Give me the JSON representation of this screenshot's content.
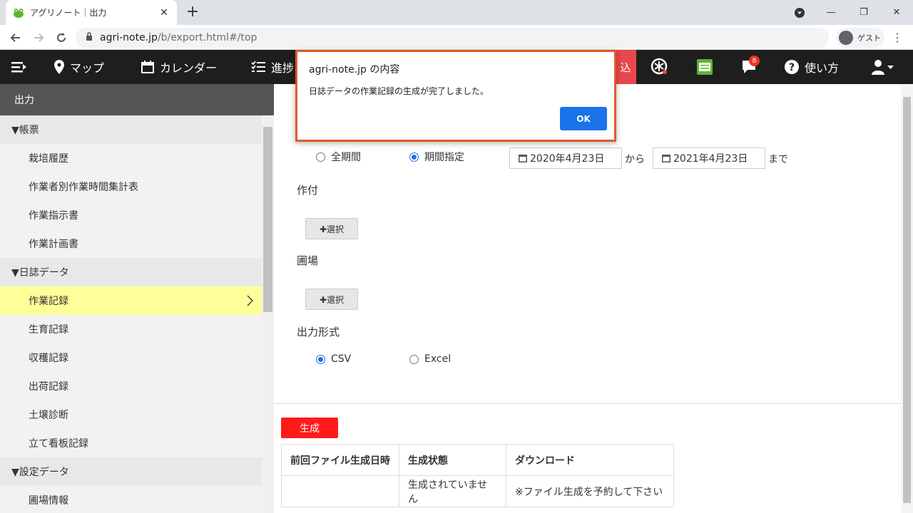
{
  "browser": {
    "tab_title": "アグリノート｜出力",
    "tab_close": "✕",
    "new_tab": "+",
    "url_host": "agri-note.jp",
    "url_path": "/b/export.html#/top",
    "guest_label": "ゲスト",
    "minimize": "—",
    "maximize": "❐",
    "close": "✕"
  },
  "appbar": {
    "map": "マップ",
    "calendar": "カレンダー",
    "progress": "進捗",
    "red_label": "込",
    "notification_count": "8",
    "help": "使い方"
  },
  "sidebar": {
    "title": "出力",
    "sections": [
      {
        "label": "▼帳票",
        "items": [
          "栽培履歴",
          "作業者別作業時間集計表",
          "作業指示書",
          "作業計画書"
        ]
      },
      {
        "label": "▼日誌データ",
        "items": [
          "作業記録",
          "生育記録",
          "収穫記録",
          "出荷記録",
          "土壌診断",
          "立て看板記録"
        ]
      },
      {
        "label": "▼設定データ",
        "items": [
          "圃場情報"
        ]
      }
    ],
    "active_item": "作業記録"
  },
  "form": {
    "period_all": "全期間",
    "period_range": "期間指定",
    "date_from": "2020年4月23日",
    "from_label": "から",
    "date_to": "2021年4月23日",
    "to_label": "まで",
    "crop_label": "作付",
    "select_label": "✚選択",
    "field_label": "圃場",
    "format_label": "出力形式",
    "format_csv": "CSV",
    "format_excel": "Excel",
    "generate": "生成"
  },
  "table": {
    "headers": [
      "前回ファイル生成日時",
      "生成状態",
      "ダウンロード"
    ],
    "row": [
      "",
      "生成されていません",
      "※ファイル生成を予約して下さい"
    ]
  },
  "dialog": {
    "title": "agri-note.jp の内容",
    "message": "日誌データの作業記録の生成が完了しました。",
    "ok": "OK"
  },
  "colors": {
    "accent_red": "#ff1a1a",
    "dialog_border": "#e05a2b",
    "active_row": "#ffff99",
    "primary_blue": "#1a73e8"
  }
}
